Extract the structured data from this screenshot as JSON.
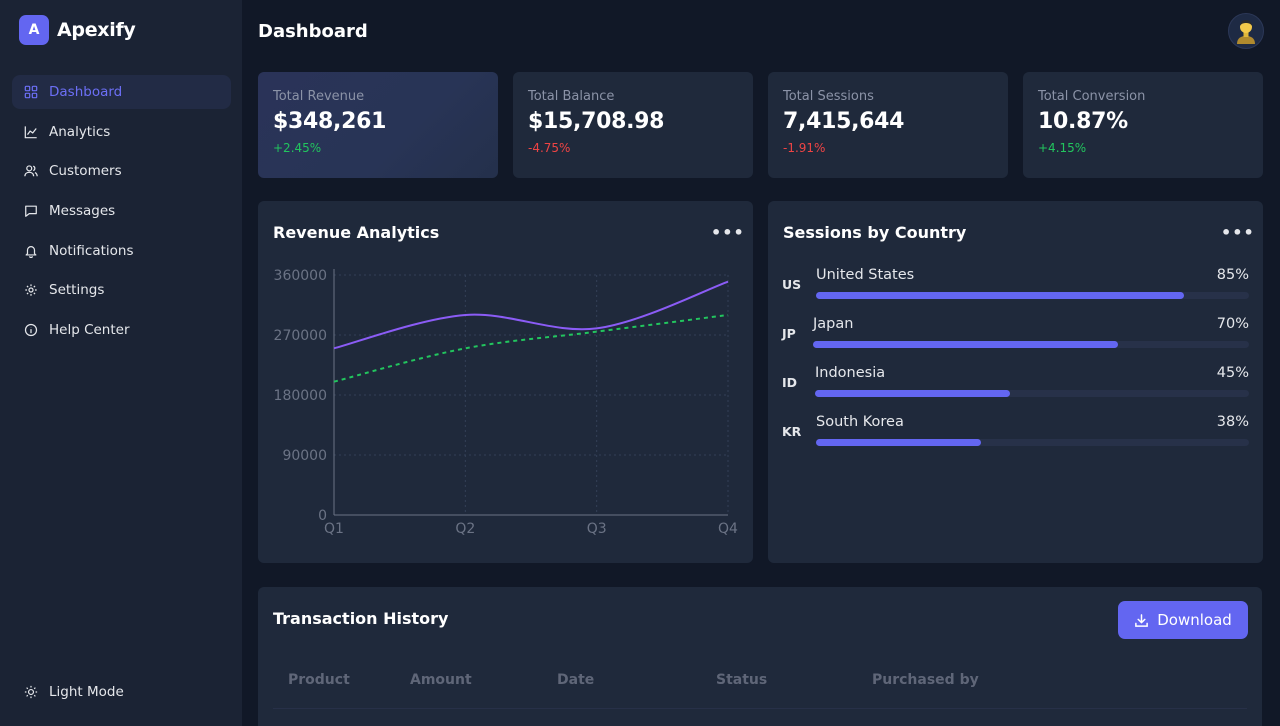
{
  "brand": {
    "logo_letter": "A",
    "name": "Apexify"
  },
  "sidebar": {
    "items": [
      {
        "label": "Dashboard",
        "icon": "grid-icon",
        "active": true
      },
      {
        "label": "Analytics",
        "icon": "chart-line-icon"
      },
      {
        "label": "Customers",
        "icon": "users-icon"
      },
      {
        "label": "Messages",
        "icon": "message-icon"
      },
      {
        "label": "Notifications",
        "icon": "bell-icon"
      },
      {
        "label": "Settings",
        "icon": "gear-icon"
      },
      {
        "label": "Help Center",
        "icon": "info-icon"
      }
    ],
    "light_mode_label": "Light Mode"
  },
  "header": {
    "title": "Dashboard"
  },
  "stats": [
    {
      "label": "Total Revenue",
      "value": "$348,261",
      "change": "+2.45%",
      "trend": "up"
    },
    {
      "label": "Total Balance",
      "value": "$15,708.98",
      "change": "-4.75%",
      "trend": "down"
    },
    {
      "label": "Total Sessions",
      "value": "7,415,644",
      "change": "-1.91%",
      "trend": "down"
    },
    {
      "label": "Total Conversion",
      "value": "10.87%",
      "change": "+4.15%",
      "trend": "up"
    }
  ],
  "revenue_panel": {
    "title": "Revenue Analytics",
    "menu": "•••"
  },
  "chart_data": {
    "type": "line",
    "categories": [
      "Q1",
      "Q2",
      "Q3",
      "Q4"
    ],
    "y_ticks": [
      "360000",
      "270000",
      "180000",
      "90000",
      "0"
    ],
    "ylim": [
      0,
      360000
    ],
    "grid": true,
    "series": [
      {
        "values": [
          250000,
          300000,
          280000,
          350000
        ],
        "color": "#8b5cf6",
        "style": "solid"
      },
      {
        "values": [
          200000,
          250000,
          275000,
          300000
        ],
        "color": "#22c55e",
        "style": "dashed"
      }
    ]
  },
  "sessions_panel": {
    "title": "Sessions by Country",
    "menu": "•••",
    "countries": [
      {
        "code": "US",
        "name": "United States",
        "pct_label": "85%",
        "pct": 0.85
      },
      {
        "code": "JP",
        "name": "Japan",
        "pct_label": "70%",
        "pct": 0.7
      },
      {
        "code": "ID",
        "name": "Indonesia",
        "pct_label": "45%",
        "pct": 0.45
      },
      {
        "code": "KR",
        "name": "South Korea",
        "pct_label": "38%",
        "pct": 0.38
      }
    ]
  },
  "transactions": {
    "title": "Transaction History",
    "download_label": "Download",
    "columns": [
      "Product",
      "Amount",
      "Date",
      "Status",
      "Purchased by"
    ]
  },
  "colors": {
    "accent": "#6366f1",
    "positive": "#22c55e",
    "negative": "#ef4444",
    "background": "#111827",
    "card": "#1f293b"
  }
}
